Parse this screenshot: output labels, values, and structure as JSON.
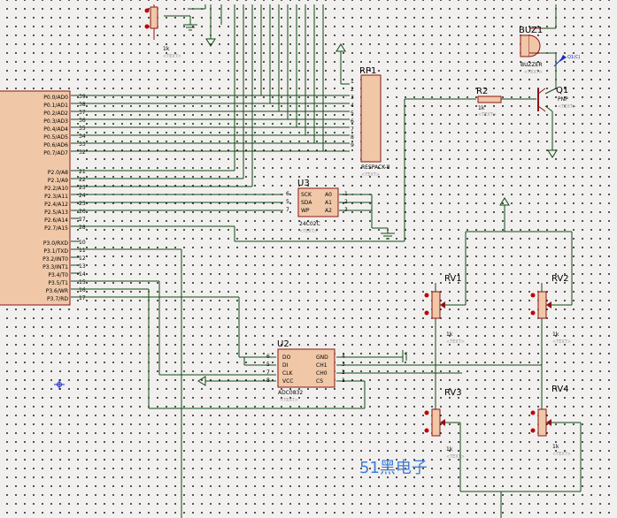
{
  "schematic": {
    "colors": {
      "background": "#f2f0ee",
      "wire": "#0d4a14",
      "component": "#8b1414",
      "body": "#f0c8a8",
      "watermark": "#3c7ed8"
    },
    "mcu": {
      "p0_pins": [
        "P0.0/AD0",
        "P0.1/AD1",
        "P0.2/AD2",
        "P0.3/AD3",
        "P0.4/AD4",
        "P0.5/AD5",
        "P0.6/AD6",
        "P0.7/AD7"
      ],
      "p0_nums": [
        "39",
        "38",
        "37",
        "36",
        "35",
        "34",
        "33",
        "32"
      ],
      "p2_pins": [
        "P2.0/A8",
        "P2.1/A9",
        "P2.2/A10",
        "P2.3/A11",
        "P2.4/A12",
        "P2.5/A13",
        "P2.6/A14",
        "P2.7/A15"
      ],
      "p2_nums": [
        "21",
        "22",
        "23",
        "24",
        "25",
        "26",
        "27",
        "28"
      ],
      "p3_pins": [
        "P3.0/RXD",
        "P3.1/TXD",
        "P3.2/INT0",
        "P3.3/INT1",
        "P3.4/T0",
        "P3.5/T1",
        "P3.6/WR",
        "P3.7/RD"
      ],
      "p3_nums": [
        "10",
        "11",
        "12",
        "13",
        "14",
        "15",
        "16",
        "17"
      ]
    },
    "top_pot": {
      "value": "1k",
      "text": "<TEXT>"
    },
    "rp1": {
      "ref": "RP1",
      "part": "RESPACK-8",
      "text": "<TEXT>",
      "pins": [
        "1",
        "2",
        "3",
        "4",
        "5",
        "6",
        "7",
        "8",
        "9"
      ]
    },
    "buz1": {
      "ref": "BUZ1",
      "part": "BUZZER",
      "text": "<TEXT>"
    },
    "probe": {
      "label": "Q1(C)"
    },
    "r2": {
      "ref": "R2",
      "value": "1k",
      "text": "<TEXT>"
    },
    "q1": {
      "ref": "Q1",
      "part": "PNP",
      "text": "<TEXT>"
    },
    "u3": {
      "ref": "U3",
      "part": "24C02C",
      "text": "<TEXT>",
      "left_pins": [
        "SCK",
        "SDA",
        "WP"
      ],
      "left_nums": [
        "6",
        "5",
        "7"
      ],
      "right_pins": [
        "A0",
        "A1",
        "A2"
      ],
      "right_nums": [
        "1",
        "2",
        "3"
      ]
    },
    "u2": {
      "ref": "U2",
      "part": "ADC0832",
      "text": "<TEXT>",
      "left_pins": [
        "DO",
        "DI",
        "CLK",
        "VCC"
      ],
      "left_nums": [
        "6",
        "5",
        "7",
        "8"
      ],
      "right_pins": [
        "GND",
        "CH1",
        "CH0",
        "CS"
      ],
      "right_nums": [
        "4",
        "3",
        "2",
        "1"
      ]
    },
    "rv": [
      {
        "ref": "RV1",
        "value": "1k",
        "text": "<TEXT>"
      },
      {
        "ref": "RV2",
        "value": "1k",
        "text": "<TEXT>"
      },
      {
        "ref": "RV3",
        "value": "1k",
        "text": "<TEXT>"
      },
      {
        "ref": "RV4",
        "value": "1k",
        "text": "<TEXT>"
      }
    ],
    "watermark": "51黑电子"
  }
}
